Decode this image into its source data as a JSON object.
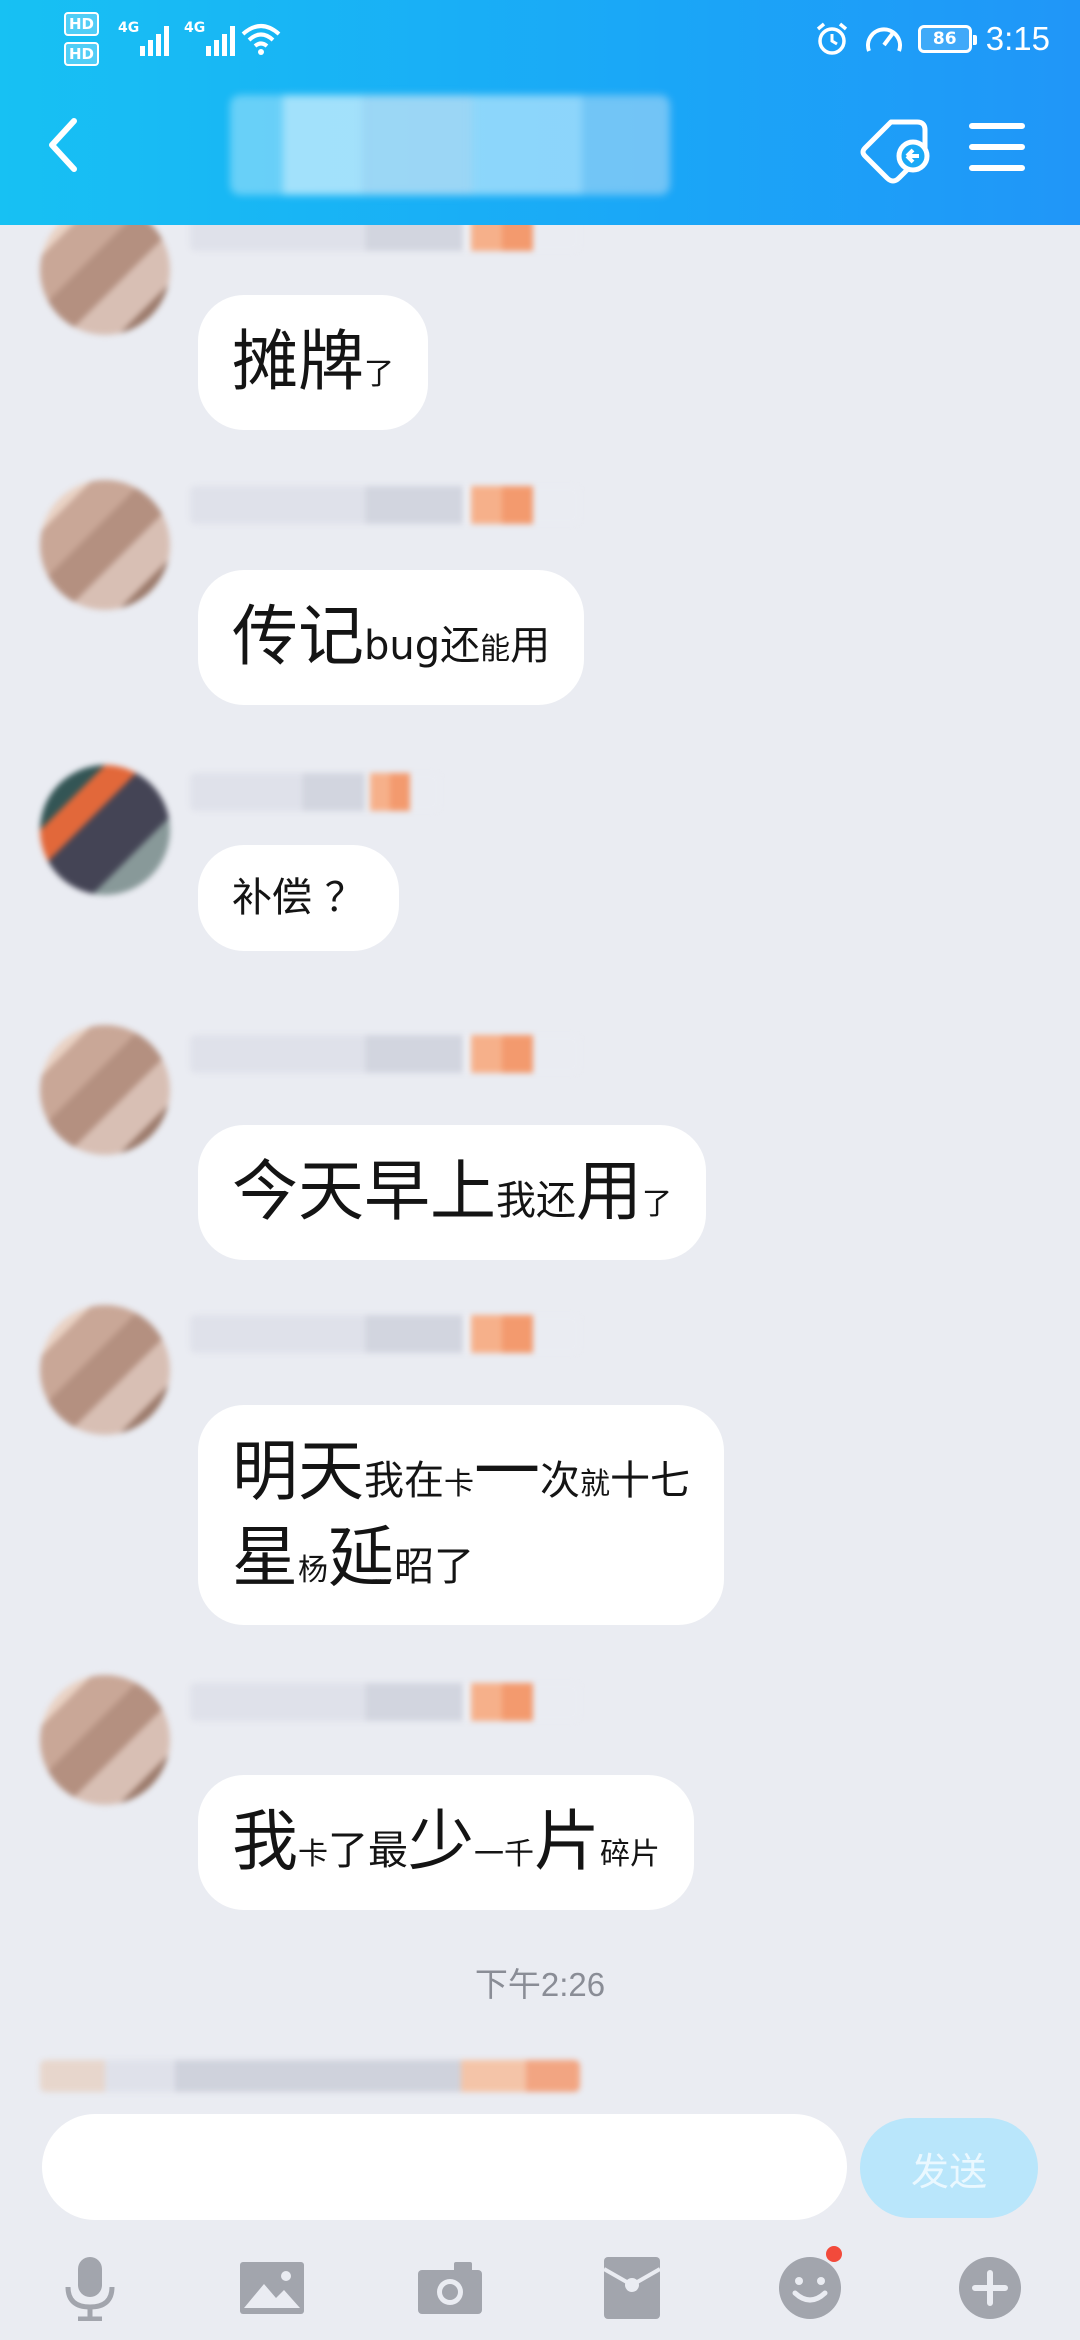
{
  "status_bar": {
    "hd1": "HD",
    "hd2": "HD",
    "net1": "4G",
    "net2": "4G",
    "battery": "86",
    "time": "3:15"
  },
  "header": {
    "back_icon": "chevron-left-icon",
    "title": "",
    "tag_icon": "tag-icon",
    "menu_icon": "menu-icon",
    "background_color": "#19b4f5"
  },
  "messages": [
    {
      "segments": [
        {
          "text": "摊牌",
          "size": "big"
        },
        {
          "text": "了",
          "size": "sm"
        }
      ]
    },
    {
      "segments": [
        {
          "text": "传记",
          "size": "big"
        },
        {
          "text": "bug还",
          "size": "mid"
        },
        {
          "text": "能",
          "size": "sm"
        },
        {
          "text": "用",
          "size": "mid"
        }
      ]
    },
    {
      "segments": [
        {
          "text": "补偿 ？",
          "size": "mid"
        }
      ]
    },
    {
      "segments": [
        {
          "text": "今天早上",
          "size": "big"
        },
        {
          "text": "我还",
          "size": "mid"
        },
        {
          "text": "用",
          "size": "big"
        },
        {
          "text": "了",
          "size": "sm"
        }
      ]
    },
    {
      "rows": [
        [
          {
            "text": "明天",
            "size": "big"
          },
          {
            "text": "我在",
            "size": "mid"
          },
          {
            "text": "卡",
            "size": "sm"
          },
          {
            "text": "一",
            "size": "big"
          },
          {
            "text": "次",
            "size": "mid"
          },
          {
            "text": "就",
            "size": "sm"
          },
          {
            "text": "十七",
            "size": "mid"
          }
        ],
        [
          {
            "text": "星",
            "size": "big"
          },
          {
            "text": "杨",
            "size": "sm"
          },
          {
            "text": "延",
            "size": "big"
          },
          {
            "text": "昭了",
            "size": "mid"
          }
        ]
      ]
    },
    {
      "segments": [
        {
          "text": "我",
          "size": "big"
        },
        {
          "text": "卡",
          "size": "sm"
        },
        {
          "text": "了最",
          "size": "mid"
        },
        {
          "text": "少",
          "size": "big"
        },
        {
          "text": "一千",
          "size": "sm"
        },
        {
          "text": "片",
          "size": "big"
        },
        {
          "text": "碎片",
          "size": "sm"
        }
      ]
    }
  ],
  "time_divider": "下午2:26",
  "composer": {
    "input_value": "",
    "send_label": "发送"
  },
  "toolbar": {
    "items": [
      "microphone-icon",
      "image-icon",
      "camera-icon",
      "red-packet-icon",
      "emoji-icon",
      "plus-icon"
    ]
  }
}
